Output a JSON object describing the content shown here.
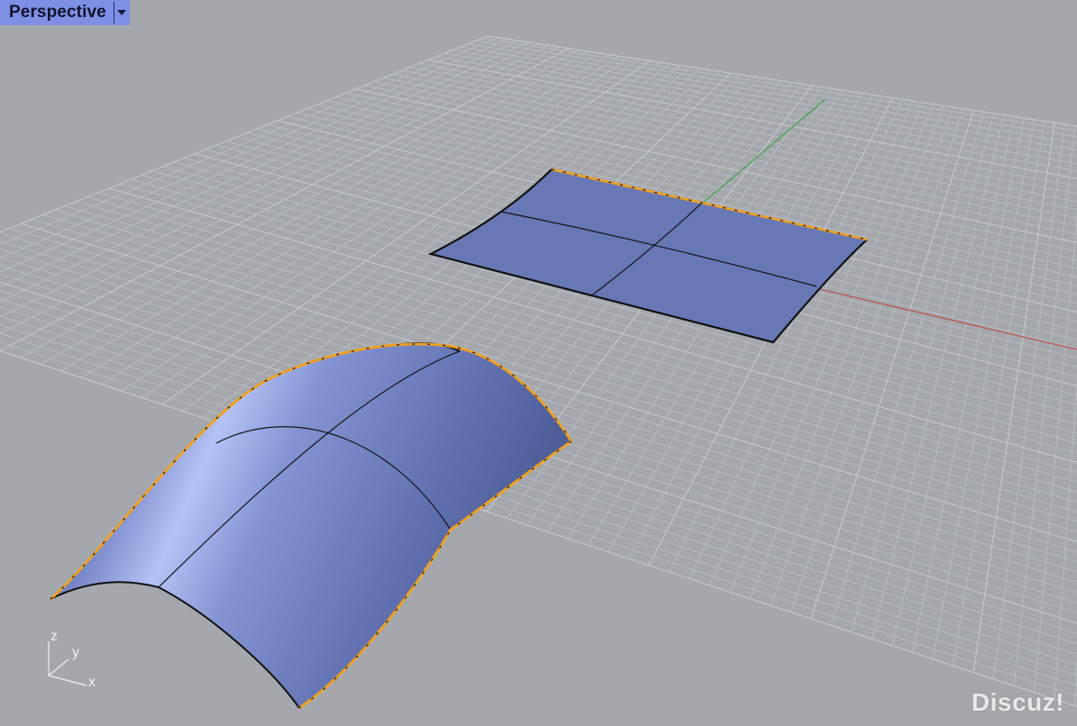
{
  "viewport": {
    "title": "Perspective",
    "menu_icon": "chevron-down-icon"
  },
  "axis_widget": {
    "z_label": "z",
    "y_label": "y",
    "x_label": "x"
  },
  "watermark": "Discuz!",
  "colors": {
    "background": "#a4a8ad",
    "grid": "#b6babf",
    "x_axis": "#b85a55",
    "y_axis": "#4aa54a",
    "surface": "#6b7cba",
    "selection_edge": "#f2a11e",
    "title_tab": "#7d90e6"
  }
}
